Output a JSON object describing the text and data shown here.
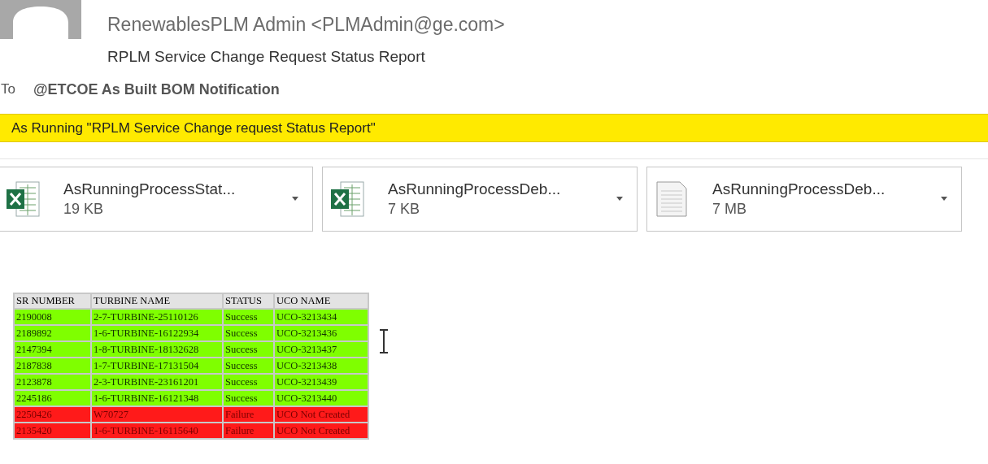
{
  "header": {
    "sender": "RenewablesPLM Admin <PLMAdmin@ge.com>",
    "subject": "RPLM Service Change Request Status Report",
    "to_label": "To",
    "to": "@ETCOE As Built BOM Notification"
  },
  "banner": "As Running \"RPLM Service Change request Status Report\"",
  "attachments": [
    {
      "kind": "excel",
      "name": "AsRunningProcessStat...",
      "size": "19 KB"
    },
    {
      "kind": "excel",
      "name": "AsRunningProcessDeb...",
      "size": "7 KB"
    },
    {
      "kind": "text",
      "name": "AsRunningProcessDeb...",
      "size": "7 MB"
    }
  ],
  "table": {
    "columns": [
      "SR NUMBER",
      "TURBINE NAME",
      "STATUS",
      "UCO NAME"
    ],
    "rows": [
      {
        "kind": "success",
        "cells": [
          "2190008",
          "2-7-TURBINE-25110126",
          "Success",
          "UCO-3213434"
        ]
      },
      {
        "kind": "success",
        "cells": [
          "2189892",
          "1-6-TURBINE-16122934",
          "Success",
          "UCO-3213436"
        ]
      },
      {
        "kind": "success",
        "cells": [
          "2147394",
          "1-8-TURBINE-18132628",
          "Success",
          "UCO-3213437"
        ]
      },
      {
        "kind": "success",
        "cells": [
          "2187838",
          "1-7-TURBINE-17131504",
          "Success",
          "UCO-3213438"
        ]
      },
      {
        "kind": "success",
        "cells": [
          "2123878",
          "2-3-TURBINE-23161201",
          "Success",
          "UCO-3213439"
        ]
      },
      {
        "kind": "success",
        "cells": [
          "2245186",
          "1-6-TURBINE-16121348",
          "Success",
          "UCO-3213440"
        ]
      },
      {
        "kind": "failure",
        "cells": [
          "2250426",
          "W70727",
          "Failure",
          "UCO Not Created"
        ]
      },
      {
        "kind": "failure",
        "cells": [
          "2135420",
          "1-6-TURBINE-16115640",
          "Failure",
          "UCO Not Created"
        ]
      }
    ]
  }
}
